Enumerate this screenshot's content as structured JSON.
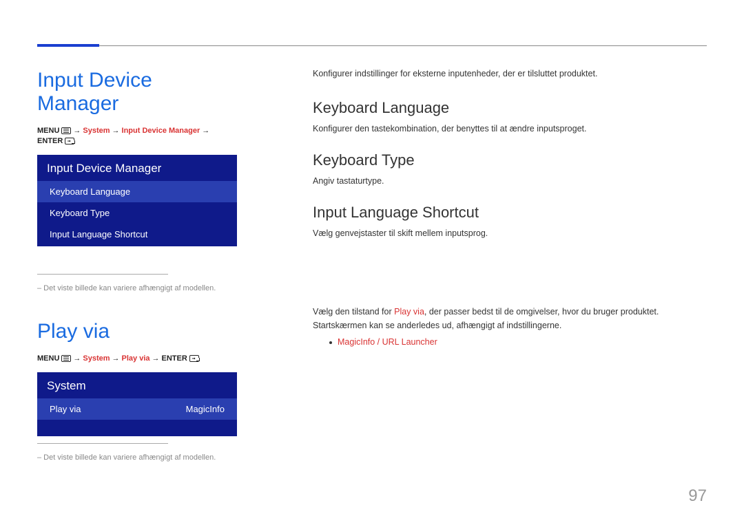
{
  "left": {
    "section1": {
      "title": "Input Device Manager",
      "breadcrumb": {
        "menu": "MENU",
        "arrow": "→",
        "l2": "System",
        "l3": "Input Device Manager",
        "enter": "ENTER"
      },
      "panel": {
        "title": "Input Device Manager",
        "items": [
          "Keyboard Language",
          "Keyboard Type",
          "Input Language Shortcut"
        ]
      },
      "note": "–  Det viste billede kan variere afhængigt af modellen."
    },
    "section2": {
      "title": "Play via",
      "breadcrumb": {
        "menu": "MENU",
        "arrow": "→",
        "l2": "System",
        "l3": "Play via",
        "enter": "ENTER"
      },
      "panel": {
        "title": "System",
        "row_label": "Play via",
        "row_value": "MagicInfo"
      },
      "note": "–  Det viste billede kan variere afhængigt af modellen."
    }
  },
  "right": {
    "intro": "Konfigurer indstillinger for eksterne inputenheder, der er tilsluttet produktet.",
    "kb_lang": {
      "heading": "Keyboard Language",
      "body": "Konfigurer den tastekombination, der benyttes til at ændre inputsproget."
    },
    "kb_type": {
      "heading": "Keyboard Type",
      "body": "Angiv tastaturtype."
    },
    "in_short": {
      "heading": "Input Language Shortcut",
      "body": "Vælg genvejstaster til skift mellem inputsprog."
    },
    "play": {
      "p1a": "Vælg den tilstand for ",
      "p1_red": "Play via",
      "p1b": ", der passer bedst til de omgivelser, hvor du bruger produktet.",
      "p2": "Startskærmen kan se anderledes ud, afhængigt af indstillingerne.",
      "bullet": "MagicInfo / URL Launcher"
    }
  },
  "page_number": "97"
}
